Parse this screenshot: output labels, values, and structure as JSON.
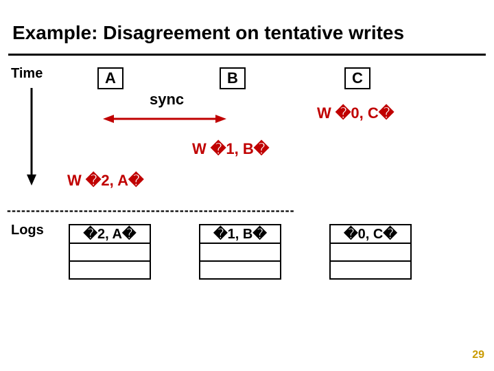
{
  "title": "Example: Disagreement on tentative writes",
  "time_label": "Time",
  "nodes": {
    "A": "A",
    "B": "B",
    "C": "C"
  },
  "sync_label": "sync",
  "writes": {
    "C": "W �0, C�",
    "B": "W �1, B�",
    "A": "W �2, A�"
  },
  "logs_label": "Logs",
  "dashes": "------------------------------------------------------------",
  "log_entries": {
    "A": "�2, A�",
    "B": "�1, B�",
    "C": "�0, C�"
  },
  "page_number": "29",
  "colors": {
    "emphasis": "#c00000",
    "pagenum": "#c99a00"
  }
}
